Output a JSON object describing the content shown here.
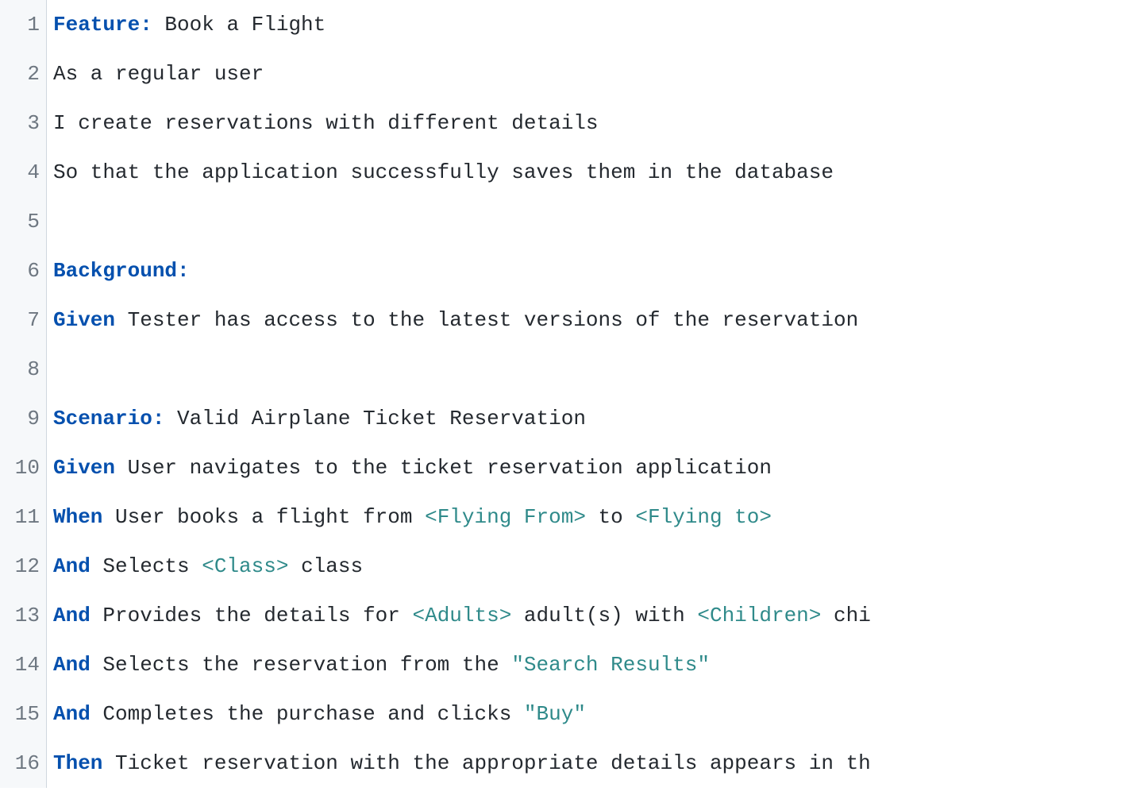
{
  "gherkin": {
    "lines": [
      {
        "n": 1,
        "segments": [
          {
            "type": "keyword",
            "text": "Feature:"
          },
          {
            "type": "plain",
            "text": " Book a Flight"
          }
        ]
      },
      {
        "n": 2,
        "segments": [
          {
            "type": "plain",
            "text": "As a regular user"
          }
        ]
      },
      {
        "n": 3,
        "segments": [
          {
            "type": "plain",
            "text": "I create reservations with different details"
          }
        ]
      },
      {
        "n": 4,
        "segments": [
          {
            "type": "plain",
            "text": "So that the application successfully saves them in the database"
          }
        ]
      },
      {
        "n": 5,
        "segments": []
      },
      {
        "n": 6,
        "segments": [
          {
            "type": "keyword",
            "text": "Background:"
          }
        ]
      },
      {
        "n": 7,
        "segments": [
          {
            "type": "keyword",
            "text": "Given"
          },
          {
            "type": "plain",
            "text": " Tester has access to the latest versions of the reservation"
          }
        ]
      },
      {
        "n": 8,
        "segments": []
      },
      {
        "n": 9,
        "segments": [
          {
            "type": "keyword",
            "text": "Scenario:"
          },
          {
            "type": "plain",
            "text": " Valid Airplane Ticket Reservation"
          }
        ]
      },
      {
        "n": 10,
        "segments": [
          {
            "type": "keyword",
            "text": "Given"
          },
          {
            "type": "plain",
            "text": " User navigates to the ticket reservation application"
          }
        ]
      },
      {
        "n": 11,
        "segments": [
          {
            "type": "keyword",
            "text": "When"
          },
          {
            "type": "plain",
            "text": " User books a flight from "
          },
          {
            "type": "param",
            "text": "<Flying From>"
          },
          {
            "type": "plain",
            "text": " to "
          },
          {
            "type": "param",
            "text": "<Flying to>"
          }
        ]
      },
      {
        "n": 12,
        "segments": [
          {
            "type": "keyword",
            "text": "And"
          },
          {
            "type": "plain",
            "text": " Selects "
          },
          {
            "type": "param",
            "text": "<Class>"
          },
          {
            "type": "plain",
            "text": " class"
          }
        ]
      },
      {
        "n": 13,
        "segments": [
          {
            "type": "keyword",
            "text": "And"
          },
          {
            "type": "plain",
            "text": " Provides the details for "
          },
          {
            "type": "param",
            "text": "<Adults>"
          },
          {
            "type": "plain",
            "text": " adult(s) with "
          },
          {
            "type": "param",
            "text": "<Children>"
          },
          {
            "type": "plain",
            "text": " chi"
          }
        ]
      },
      {
        "n": 14,
        "segments": [
          {
            "type": "keyword",
            "text": "And"
          },
          {
            "type": "plain",
            "text": " Selects the reservation from the "
          },
          {
            "type": "string",
            "text": "\"Search Results\""
          }
        ]
      },
      {
        "n": 15,
        "segments": [
          {
            "type": "keyword",
            "text": "And"
          },
          {
            "type": "plain",
            "text": " Completes the purchase and clicks "
          },
          {
            "type": "string",
            "text": "\"Buy\""
          }
        ]
      },
      {
        "n": 16,
        "segments": [
          {
            "type": "keyword",
            "text": "Then"
          },
          {
            "type": "plain",
            "text": " Ticket reservation with the appropriate details appears in th"
          }
        ]
      }
    ]
  }
}
